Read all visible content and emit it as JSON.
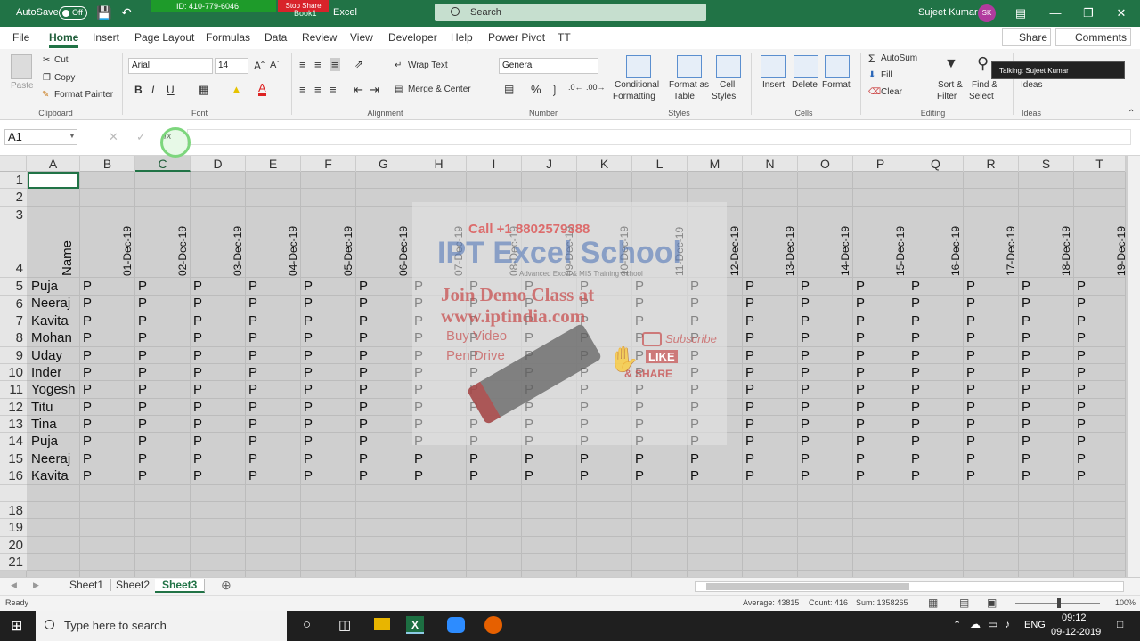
{
  "titlebar": {
    "autosave_label": "AutoSave",
    "autosave_state": "Off",
    "meeting_id": "ID: 410-779-6046",
    "stop_share": "Stop Share",
    "title": "Excel",
    "title_hidden": "Book1",
    "search_placeholder": "Search",
    "user_name": "Sujeet Kumar",
    "user_initials": "SK"
  },
  "menu": {
    "tabs": [
      "File",
      "Home",
      "Insert",
      "Page Layout",
      "Formulas",
      "Data",
      "Review",
      "View",
      "Developer",
      "Help",
      "Power Pivot",
      "TT"
    ],
    "active": "Home",
    "share": "Share",
    "comments": "Comments"
  },
  "ribbon": {
    "clipboard": {
      "paste": "Paste",
      "cut": "Cut",
      "copy": "Copy",
      "format_painter": "Format Painter",
      "label": "Clipboard"
    },
    "font": {
      "name": "Arial",
      "size": "14",
      "bold": "B",
      "italic": "I",
      "underline": "U",
      "label": "Font"
    },
    "alignment": {
      "wrap_text": "Wrap Text",
      "merge_center": "Merge & Center",
      "label": "Alignment"
    },
    "number": {
      "format": "General",
      "label": "Number"
    },
    "styles": {
      "conditional_1": "Conditional",
      "conditional_2": "Formatting",
      "format_as_1": "Format as",
      "format_as_2": "Table",
      "cell_styles_1": "Cell",
      "cell_styles_2": "Styles",
      "label": "Styles"
    },
    "cells": {
      "insert": "Insert",
      "delete": "Delete",
      "format": "Format",
      "label": "Cells"
    },
    "editing": {
      "autosum": "AutoSum",
      "fill": "Fill",
      "clear": "Clear",
      "sort_1": "Sort &",
      "sort_2": "Filter",
      "find_1": "Find &",
      "find_2": "Select",
      "label": "Editing"
    },
    "ideas": {
      "ideas": "Ideas",
      "label": "Ideas"
    },
    "tooltip": "Talking: Sujeet Kumar"
  },
  "formula_bar": {
    "name_box": "A1",
    "fx": "fx",
    "value": ""
  },
  "columns": [
    "A",
    "B",
    "C",
    "D",
    "E",
    "F",
    "G",
    "H",
    "I",
    "J",
    "K",
    "L",
    "M",
    "N",
    "O",
    "P",
    "Q",
    "R",
    "S",
    "T"
  ],
  "rows": [
    "1",
    "2",
    "3",
    "4",
    "5",
    "6",
    "7",
    "8",
    "9",
    "10",
    "11",
    "12",
    "13",
    "14",
    "15",
    "16",
    "18",
    "19",
    "20",
    "21"
  ],
  "header_cell": "Name",
  "dates": [
    "01-Dec-19",
    "02-Dec-19",
    "03-Dec-19",
    "04-Dec-19",
    "05-Dec-19",
    "06-Dec-19",
    "07-Dec-19",
    "08-Dec-19",
    "09-Dec-19",
    "10-Dec-19",
    "11-Dec-19",
    "12-Dec-19",
    "13-Dec-19",
    "14-Dec-19",
    "15-Dec-19",
    "16-Dec-19",
    "17-Dec-19",
    "18-Dec-19",
    "19-Dec-19"
  ],
  "names": [
    "Puja",
    "Neeraj",
    "Kavita",
    "Mohan",
    "Uday",
    "Inder",
    "Yogesh",
    "Titu",
    "Tina",
    "Puja",
    "Neeraj",
    "Kavita"
  ],
  "mark": "P",
  "watermark": {
    "call": "Call +1 8802579388",
    "brand": "IPT Excel School",
    "tagline": "Advanced Excel & MIS Training School",
    "join": "Join Demo Class at",
    "url": "www.iptindia.com",
    "buy_video": "Buy Video",
    "pen_drive": "Pen Drive",
    "subscribe": "Subscribe",
    "like": "LIKE",
    "share": "& SHARE"
  },
  "sheets": {
    "tabs": [
      "Sheet1",
      "Sheet2",
      "Sheet3"
    ],
    "active": "Sheet3"
  },
  "status": {
    "ready": "Ready",
    "average": "Average: 43815",
    "count": "Count: 416",
    "sum": "Sum: 1358265",
    "zoom": "100%"
  },
  "taskbar": {
    "search": "Type here to search",
    "lang": "ENG",
    "time": "09:12",
    "date": "09-12-2019"
  },
  "colors": {
    "brand": "#217346",
    "sheet_bg": "#cfcfcf"
  }
}
